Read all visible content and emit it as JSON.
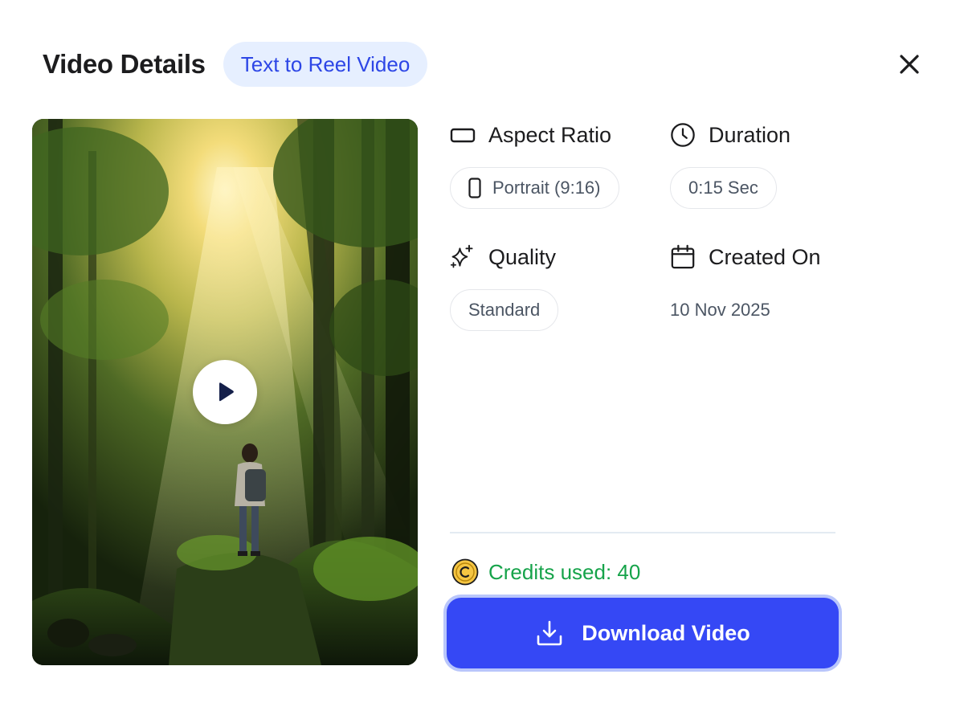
{
  "header": {
    "title": "Video Details",
    "type_badge": "Text to Reel Video",
    "close_icon": "close-icon"
  },
  "preview": {
    "description_icon": "play-icon"
  },
  "details": {
    "aspect_ratio": {
      "label": "Aspect Ratio",
      "value": "Portrait (9:16)",
      "icon": "aspect-ratio-icon"
    },
    "duration": {
      "label": "Duration",
      "value": "0:15 Sec",
      "icon": "clock-icon"
    },
    "quality": {
      "label": "Quality",
      "value": "Standard",
      "icon": "sparkles-icon"
    },
    "created_on": {
      "label": "Created On",
      "value": "10 Nov 2025",
      "icon": "calendar-icon"
    }
  },
  "credits": {
    "text": "Credits used: 40",
    "icon": "coin-icon"
  },
  "actions": {
    "download_label": "Download Video",
    "download_icon": "download-icon"
  },
  "colors": {
    "accent": "#3548f5",
    "badge_bg": "#e6efff",
    "badge_text": "#2d46e6",
    "credits_green": "#16a34a"
  }
}
